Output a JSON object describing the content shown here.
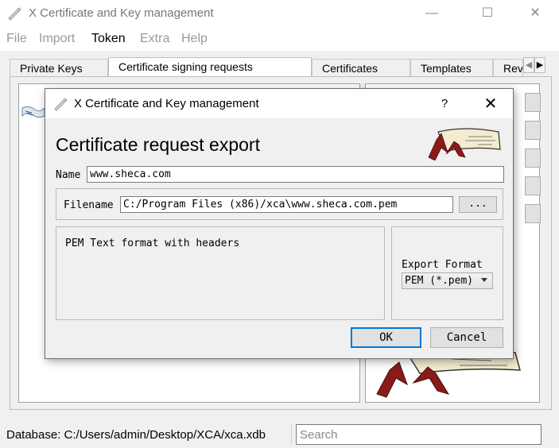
{
  "window": {
    "title": "X Certificate and Key management",
    "controls": {
      "minimize": "—",
      "maximize": "☐",
      "close": "✕"
    }
  },
  "menu": [
    "File",
    "Import",
    "Token",
    "Extra",
    "Help"
  ],
  "tabs": [
    "Private Keys",
    "Certificate signing requests",
    "Certificates",
    "Templates",
    "Revocation lists"
  ],
  "selected_tab": "Certificate signing requests",
  "statusbar": {
    "database": "Database: C:/Users/admin/Desktop/XCA/xca.xdb",
    "search_placeholder": "Search"
  },
  "dialog": {
    "title": "X Certificate and Key management",
    "help": "?",
    "close": "✕",
    "heading": "Certificate request export",
    "name_label": "Name",
    "name_value": "www.sheca.com",
    "filename_label": "Filename",
    "filename_value": "C:/Program Files (x86)/xca\\www.sheca.com.pem",
    "browse_label": "...",
    "description": "PEM Text format with headers",
    "format_label": "Export Format",
    "format_value": "PEM (*.pem)",
    "ok_label": "OK",
    "cancel_label": "Cancel"
  },
  "colors": {
    "accent": "#0078d7",
    "logo_red": "#8b1a1a",
    "logo_paper": "#f3ecd0"
  }
}
